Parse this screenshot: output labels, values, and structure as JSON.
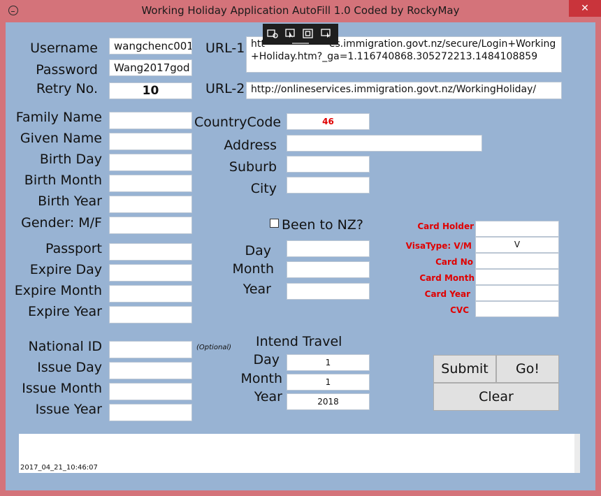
{
  "window": {
    "title": "Working Holiday Application AutoFill 1.0  Coded by RockyMay",
    "close_glyph": "✕"
  },
  "login": {
    "username_label": "Username",
    "username_value": "wangchenc001",
    "password_label": "Password",
    "password_value": "Wang2017god",
    "retry_label": "Retry No.",
    "retry_value": "10"
  },
  "urls": {
    "url1_label": "URL-1",
    "url1_value": "https://onlineservices.immigration.govt.nz/secure/Login+Working+Holiday.htm?_ga=1.116740868.305272213.1484108859",
    "url1_visible_prefix": "htt",
    "url1_visible_rest": "es.immigration.govt.nz/secure/Login+Working",
    "url1_line2": "+Holiday.htm?_ga=1.116740868.305272213.1484108859",
    "url2_label": "URL-2",
    "url2_value": "http://onlineservices.immigration.govt.nz/WorkingHoliday/"
  },
  "personal": {
    "family_name_label": "Family Name",
    "given_name_label": "Given Name",
    "birth_day_label": "Birth Day",
    "birth_month_label": "Birth Month",
    "birth_year_label": "Birth Year",
    "gender_label": "Gender: M/F"
  },
  "passport": {
    "passport_label": "Passport",
    "expire_day_label": "Expire Day",
    "expire_month_label": "Expire Month",
    "expire_year_label": "Expire Year"
  },
  "national_id": {
    "national_id_label": "National ID",
    "optional_note": "(Optional)",
    "issue_day_label": "Issue Day",
    "issue_month_label": "Issue Month",
    "issue_year_label": "Issue Year"
  },
  "address": {
    "country_code_label": "CountryCode",
    "country_code_value": "46",
    "address_label": "Address",
    "suburb_label": "Suburb",
    "city_label": "City"
  },
  "been_to_nz": {
    "label": "Been to NZ?",
    "checked": false,
    "day_label": "Day",
    "month_label": "Month",
    "year_label": "Year"
  },
  "travel": {
    "heading": "Intend Travel",
    "day_label": "Day",
    "day_value": "1",
    "month_label": "Month",
    "month_value": "1",
    "year_label": "Year",
    "year_value": "2018"
  },
  "card": {
    "holder_label": "Card Holder",
    "visa_type_label": "VisaType: V/M",
    "visa_type_value": "V",
    "card_no_label": "Card No",
    "card_month_label": "Card Month",
    "card_year_label": "Card Year",
    "cvc_label": "CVC"
  },
  "buttons": {
    "submit": "Submit",
    "go": "Go!",
    "clear": "Clear"
  },
  "log": {
    "timestamp": "2017_04_21_10:46:07"
  },
  "colors": {
    "titlebar": "#d4737a",
    "client_bg": "#98b3d3",
    "close_button": "#c9343b",
    "red_text": "#e00000"
  }
}
